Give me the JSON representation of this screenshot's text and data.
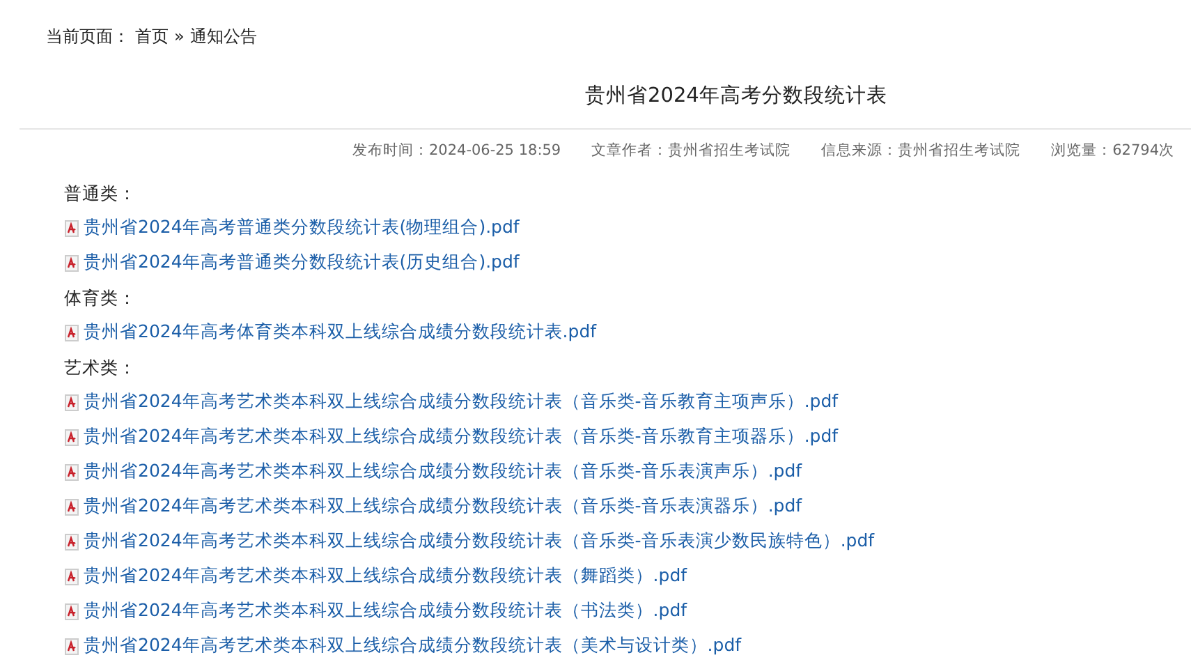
{
  "breadcrumb": {
    "label": "当前页面：",
    "items": [
      {
        "text": "首页"
      },
      {
        "text": "»"
      },
      {
        "text": "通知公告"
      }
    ]
  },
  "article": {
    "title": "贵州省2024年高考分数段统计表",
    "meta": [
      "发布时间：2024-06-25 18:59",
      "文章作者：贵州省招生考试院",
      "信息来源：贵州省招生考试院",
      "浏览量：62794次"
    ],
    "sections": [
      {
        "heading": "普通类：",
        "files": [
          "贵州省2024年高考普通类分数段统计表(物理组合).pdf",
          "贵州省2024年高考普通类分数段统计表(历史组合).pdf"
        ]
      },
      {
        "heading": "体育类：",
        "files": [
          "贵州省2024年高考体育类本科双上线综合成绩分数段统计表.pdf"
        ]
      },
      {
        "heading": "艺术类：",
        "files": [
          "贵州省2024年高考艺术类本科双上线综合成绩分数段统计表（音乐类-音乐教育主项声乐）.pdf",
          "贵州省2024年高考艺术类本科双上线综合成绩分数段统计表（音乐类-音乐教育主项器乐）.pdf",
          "贵州省2024年高考艺术类本科双上线综合成绩分数段统计表（音乐类-音乐表演声乐）.pdf",
          "贵州省2024年高考艺术类本科双上线综合成绩分数段统计表（音乐类-音乐表演器乐）.pdf",
          "贵州省2024年高考艺术类本科双上线综合成绩分数段统计表（音乐类-音乐表演少数民族特色）.pdf",
          "贵州省2024年高考艺术类本科双上线综合成绩分数段统计表（舞蹈类）.pdf",
          "贵州省2024年高考艺术类本科双上线综合成绩分数段统计表（书法类）.pdf",
          "贵州省2024年高考艺术类本科双上线综合成绩分数段统计表（美术与设计类）.pdf"
        ]
      }
    ]
  }
}
